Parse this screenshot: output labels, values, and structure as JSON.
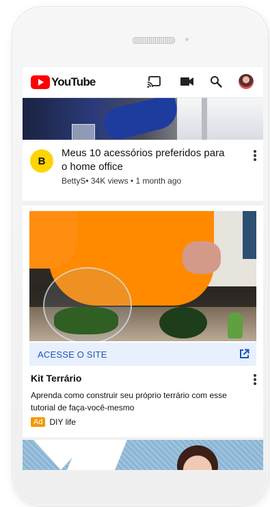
{
  "header": {
    "logo_text": "YouTube",
    "icons": [
      "cast-icon",
      "video-camera-icon",
      "search-icon",
      "account-avatar"
    ]
  },
  "video1": {
    "channel_initial": "B",
    "title": "Meus 10 acessórios preferidos para o home office",
    "meta": "BettyS• 34K views • 1 month ago"
  },
  "ad": {
    "cta_label": "ACESSE O SITE",
    "title": "Kit Terrário",
    "description": "Aprenda como construir seu próprio terrário com esse tutorial de faça-você-mesmo",
    "badge": "Ad",
    "advertiser": "DIY life"
  },
  "colors": {
    "youtube_red": "#ff0000",
    "cta_background": "#e8f0fe",
    "cta_text": "#1a56b8",
    "ad_badge": "#f29900",
    "channel_logo": "#ffd400"
  }
}
